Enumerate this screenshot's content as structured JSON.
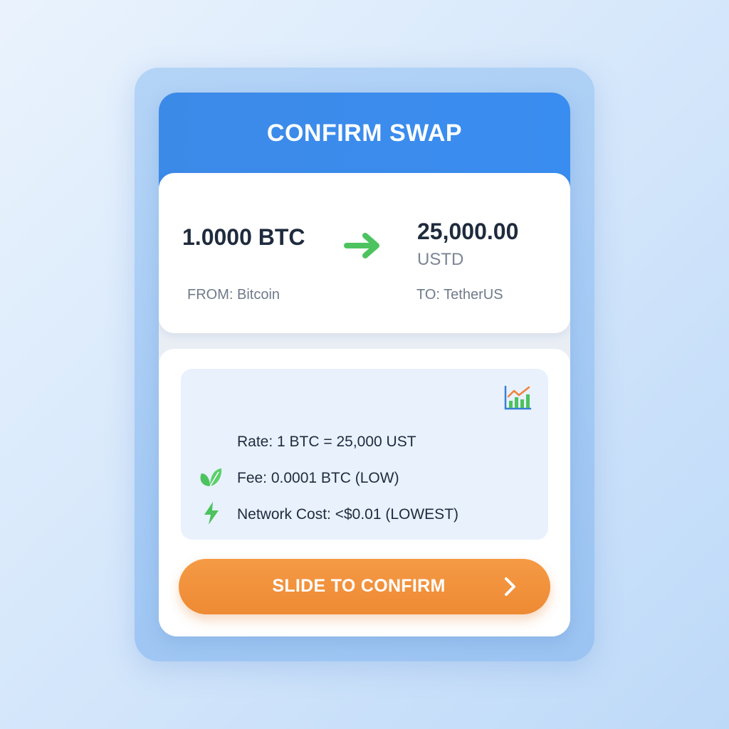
{
  "header": {
    "title": "CONFIRM SWAP"
  },
  "swap": {
    "from_amount": "1.0000 BTC",
    "from_label": "FROM: Bitcoin",
    "to_amount": "25,000.00",
    "to_unit": "USTD",
    "to_label": "TO: TetherUS",
    "arrow_icon": "arrow-right-icon"
  },
  "details": {
    "chart_icon": "chart-icon",
    "rate": "Rate: 1 BTC = 25,000 UST",
    "fee": "Fee: 0.0001 BTC (LOW)",
    "fee_icon": "leaf-icon",
    "network": "Network Cost: <$0.01 (LOWEST)",
    "network_icon": "lightning-icon"
  },
  "action": {
    "slide_label": "SLIDE TO CONFIRM",
    "chevron_icon": "chevron-right-icon"
  },
  "colors": {
    "header_blue": "#3a8cec",
    "accent_green": "#4cc35e",
    "button_orange": "#f0903a",
    "text_dark": "#1f2b3d",
    "text_muted": "#6f7a8a"
  }
}
